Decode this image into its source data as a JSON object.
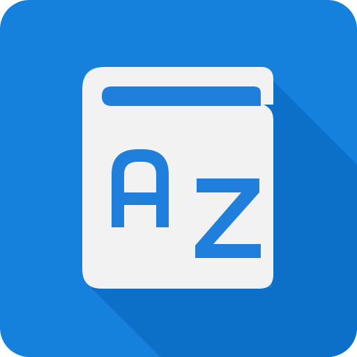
{
  "icon": {
    "name": "dictionary-app-icon",
    "letters": [
      "A",
      "Z"
    ]
  },
  "colors": {
    "background": "#1581DD",
    "shadow": "#0C6FC8",
    "book": "#F2F2F2",
    "letters": "#1F7FDB"
  }
}
